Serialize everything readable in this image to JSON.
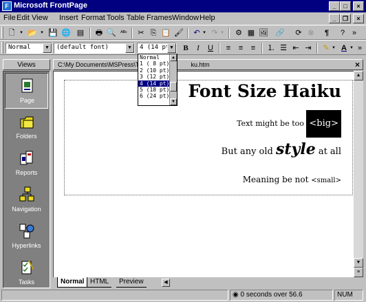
{
  "window": {
    "title": "Microsoft FrontPage"
  },
  "menu": [
    "File",
    "Edit",
    "View",
    "Insert",
    "Format",
    "Tools",
    "Table",
    "Frames",
    "Window",
    "Help"
  ],
  "formatting": {
    "style": "Normal",
    "font": "(default font)",
    "size": "4  (14 pt)"
  },
  "size_dropdown": {
    "options": [
      "Normal",
      "1  ( 8 pt)",
      "2  (10 pt)",
      "3  (12 pt)",
      "4  (14 pt)",
      "5  (18 pt)",
      "6  (24 pt)"
    ],
    "selected_index": 4
  },
  "views": {
    "header": "Views",
    "items": [
      {
        "label": "Page",
        "icon": "page-icon",
        "active": true
      },
      {
        "label": "Folders",
        "icon": "folders-icon",
        "active": false
      },
      {
        "label": "Reports",
        "icon": "reports-icon",
        "active": false
      },
      {
        "label": "Navigation",
        "icon": "navigation-icon",
        "active": false
      },
      {
        "label": "Hyperlinks",
        "icon": "hyperlinks-icon",
        "active": false
      },
      {
        "label": "Tasks",
        "icon": "tasks-icon",
        "active": false
      }
    ]
  },
  "document": {
    "path": "C:\\My Documents\\MSPress\\T",
    "path_end": "ku.htm",
    "title": "Font Size Haiku",
    "line1_text": "Text might be too ",
    "line1_tag": "<big>",
    "line2_before": "But any old ",
    "line2_style": "style",
    "line2_after": " at all",
    "line3_text": "Meaning be not ",
    "line3_tag": "<small>"
  },
  "tabs": [
    "Normal",
    "HTML",
    "Preview"
  ],
  "status": {
    "timing": "0 seconds over 56.6",
    "num": "NUM"
  },
  "colors": {
    "titlebar": "#000080",
    "selection": "#000080",
    "views_bg": "#808080",
    "chrome": "#c0c0c0"
  }
}
